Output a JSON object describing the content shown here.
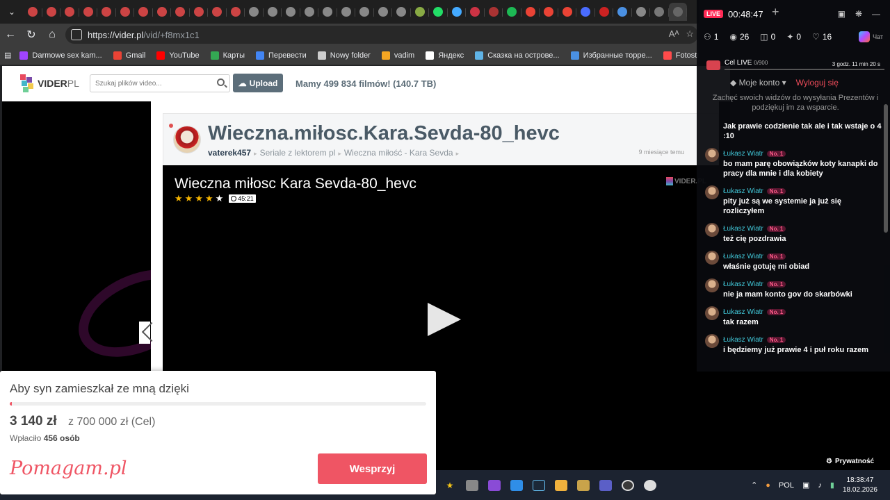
{
  "browser": {
    "url_host": "https://vider.pl",
    "url_path": "/vid/+f8mx1c1",
    "omni_icons": [
      "Aᴬ",
      "☆"
    ]
  },
  "bookmarks": [
    {
      "label": "Darmowe sex kam...",
      "color": "#a044ff"
    },
    {
      "label": "Gmail",
      "color": "#ea4335"
    },
    {
      "label": "YouTube",
      "color": "#ff0000"
    },
    {
      "label": "Карты",
      "color": "#34a853"
    },
    {
      "label": "Перевести",
      "color": "#4285f4"
    },
    {
      "label": "Nowy folder",
      "color": "#cccccc"
    },
    {
      "label": "vadim",
      "color": "#f5a623"
    },
    {
      "label": "Яндекс",
      "color": "#ffffff"
    },
    {
      "label": "Сказка на острове...",
      "color": "#5fb3e6"
    },
    {
      "label": "Избранные торре...",
      "color": "#4a90e2"
    },
    {
      "label": "Fotostrana - No Int...",
      "color": "#ff4b4b"
    }
  ],
  "site": {
    "logo_main": "VIDER",
    "logo_suffix": "PL",
    "search_placeholder": "Szukaj plików video...",
    "upload_label": "Upload",
    "tagline": "Mamy 499 834 filmów! (140.7 TB)"
  },
  "video": {
    "title": "Wieczna.miłosc.Kara.Sevda-80_hevc",
    "uploader": "vaterek457",
    "crumb1": "Seriale z lektorem pl",
    "crumb2": "Wieczna miłość - Kara Sevda",
    "time_ago": "9 miesiące temu",
    "player_title": "Wieczna miłosc Kara Sevda-80_hevc",
    "rating": 4,
    "rating_max": 5,
    "duration": "45:21",
    "watermark": "VIDER.PL"
  },
  "donation": {
    "title": "Aby syn zamieszkał ze mną dzięki",
    "amount": "3 140 zł",
    "goal": "z 700 000 zł (Cel)",
    "paid_label": "Wpłaciło",
    "paid_count": "456 osób",
    "progress": 0.0045,
    "brand": "Pomagam.pl",
    "button": "Wesprzyj",
    "accent": "#ef5564"
  },
  "live": {
    "badge": "LIVE",
    "timer": "00:48:47",
    "stats": {
      "users": "1",
      "views": "26",
      "gifts": "0",
      "shares": "0",
      "likes": "16"
    },
    "chat_label": "Чат",
    "goal_name": "Cel LIVE",
    "goal_count": "0/900",
    "goal_time": "3 godz. 11 min 20 s",
    "account": "Moje konto",
    "logout": "Wyloguj się",
    "promo": "Zachęć swoich widzów do wysyłania Prezentów i podziękuj im za wsparcie.",
    "messages": [
      {
        "name": "",
        "badge": "",
        "text": "Jak prawie codzienie tak ale i tak wstaje o 4 :10"
      },
      {
        "name": "Łukasz Wiatr",
        "badge": "No. 1",
        "text": "bo mam parę obowiązków koty kanapki do pracy dla mnie i dla kobiety"
      },
      {
        "name": "Łukasz Wiatr",
        "badge": "No. 1",
        "text": "pity już są we systemie ja już się rozliczyłem"
      },
      {
        "name": "Łukasz Wiatr",
        "badge": "No. 1",
        "text": "też cię pozdrawia"
      },
      {
        "name": "Łukasz Wiatr",
        "badge": "No. 1",
        "text": "właśnie gotuję mi obiad"
      },
      {
        "name": "Łukasz Wiatr",
        "badge": "No. 1",
        "text": "nie ja mam konto gov do skarbówki"
      },
      {
        "name": "Łukasz Wiatr",
        "badge": "No. 1",
        "text": "tak razem"
      },
      {
        "name": "Łukasz Wiatr",
        "badge": "No. 1",
        "text": "i będziemy już prawie 4 i puł roku razem"
      }
    ],
    "privacy": "Prywatność"
  },
  "taskbar": {
    "lang": "POL",
    "time": "18:38:47",
    "date": "18.02.2026"
  }
}
